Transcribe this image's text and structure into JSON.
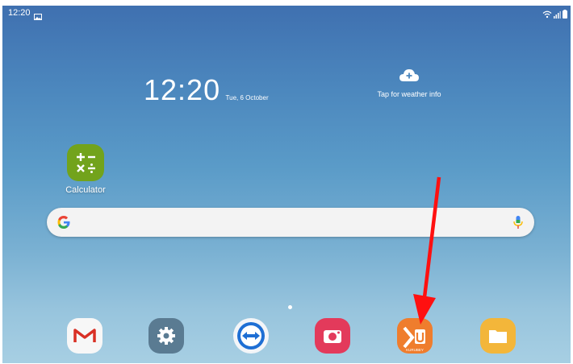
{
  "status_bar": {
    "time": "12:20",
    "icons": [
      "gallery-icon",
      "wifi-icon",
      "signal-icon",
      "battery-icon"
    ]
  },
  "clock_widget": {
    "time": "12:20",
    "date": "Tue, 6 October"
  },
  "weather_widget": {
    "icon": "cloud-plus-icon",
    "text": "Tap for weather info"
  },
  "home_apps": [
    {
      "label": "Calculator",
      "icon": "calculator-icon",
      "color": "#72a31c"
    }
  ],
  "search_bar": {
    "logo": "G",
    "icons": [
      "google-logo",
      "mic-icon"
    ]
  },
  "page_indicator": {
    "pages": 1,
    "current": 1
  },
  "dock": [
    {
      "name": "gmail-icon",
      "color": "#f7f7f7"
    },
    {
      "name": "settings-icon",
      "color": "#5a7b92"
    },
    {
      "name": "teamviewer-icon",
      "color": "#f3f5f8"
    },
    {
      "name": "camera-icon",
      "color": "#e33a5b"
    },
    {
      "name": "kurubey-icon",
      "color": "#ef7d2d",
      "text": "KURUBEY"
    },
    {
      "name": "files-icon",
      "color": "#f3b63a"
    }
  ],
  "annotation": {
    "type": "red-arrow",
    "color": "#ff1010",
    "points_to": "kurubey-icon"
  }
}
